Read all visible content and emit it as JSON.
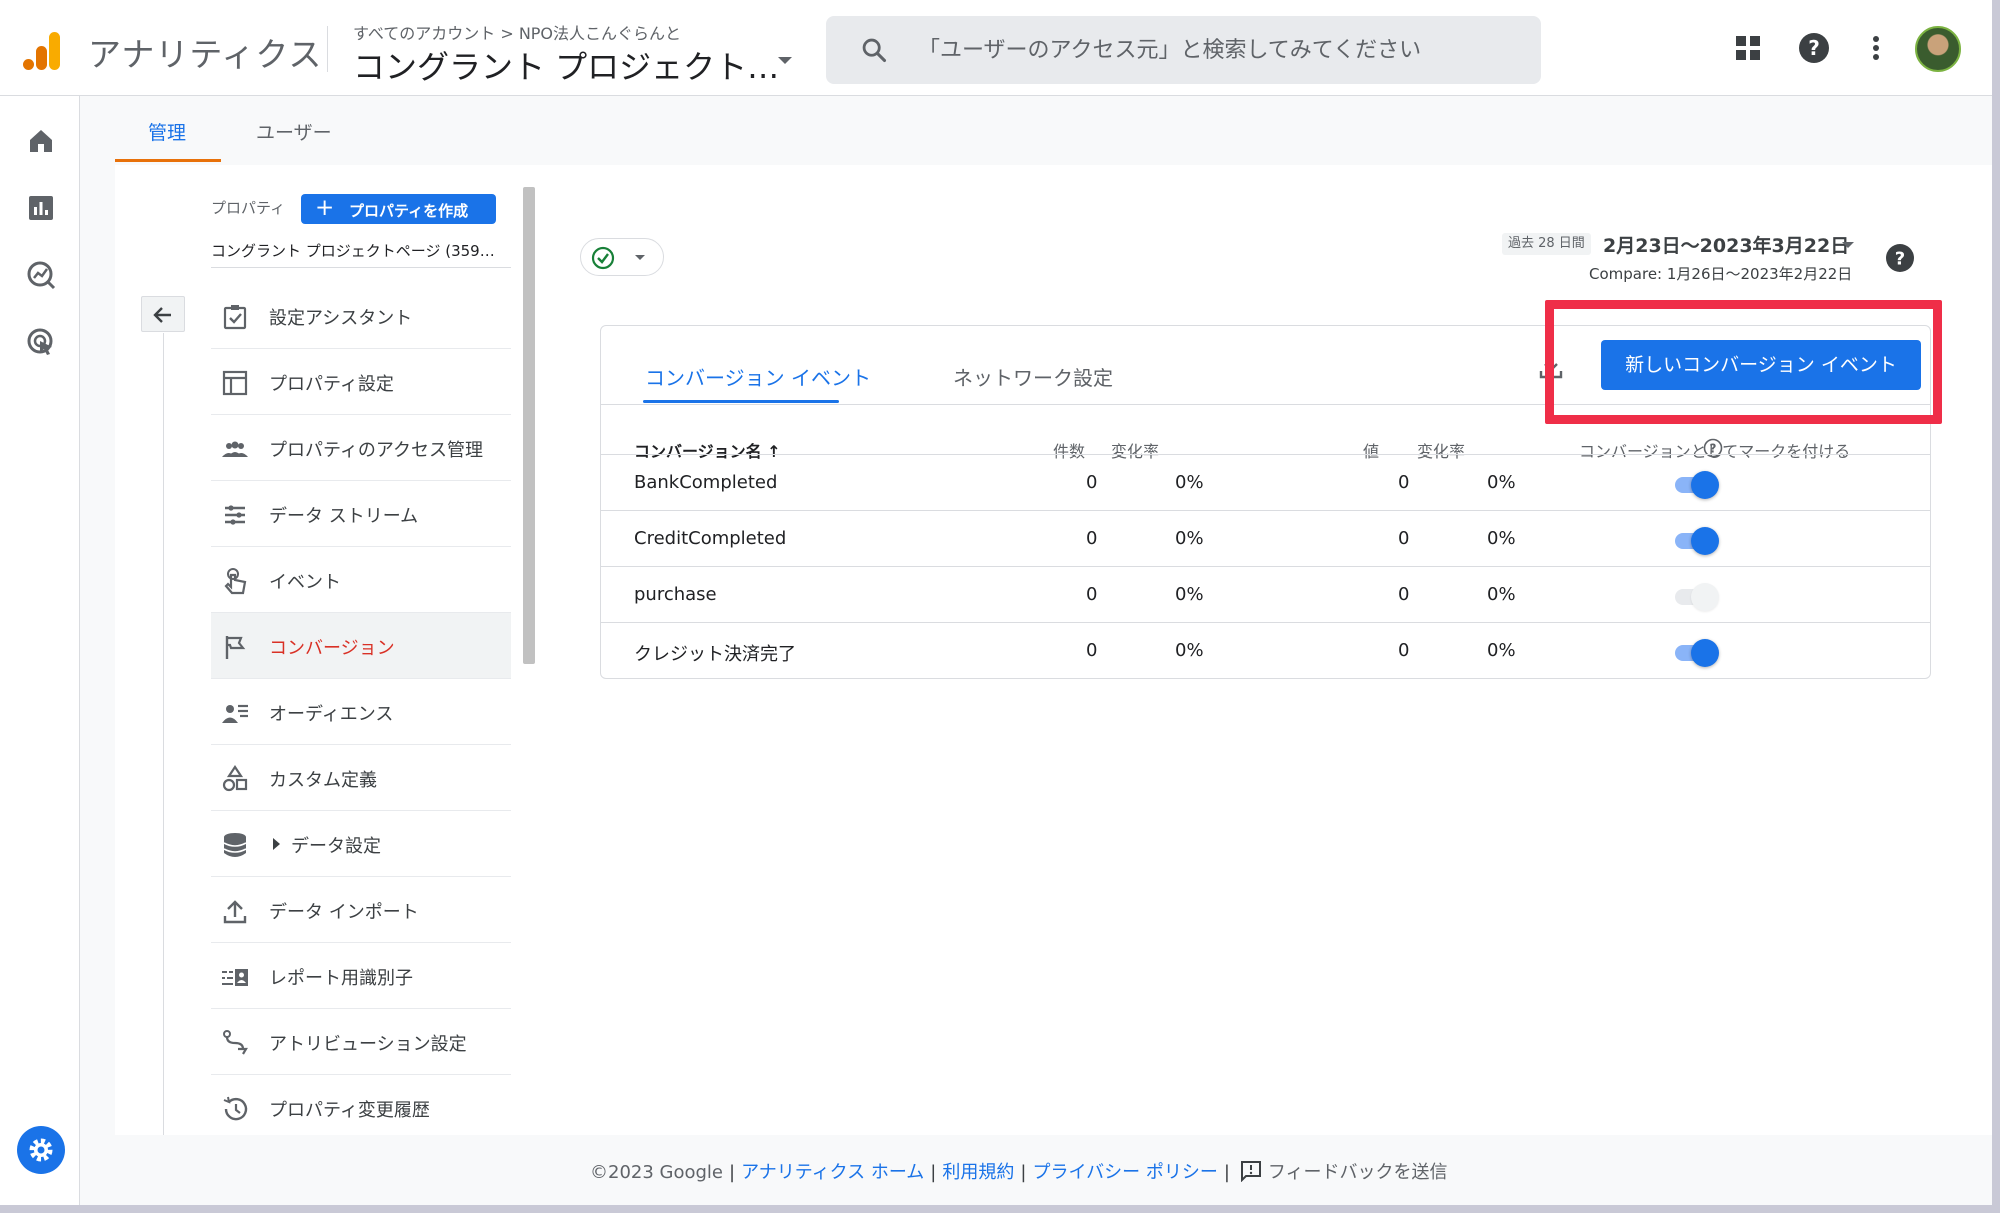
{
  "header": {
    "app_name": "アナリティクス",
    "breadcrumb": "すべてのアカウント > NPO法人こんぐらんと",
    "property_title": "コングラント プロジェクト…",
    "search_placeholder": "「ユーザーのアクセス元」と検索してみてください"
  },
  "admin_tabs": [
    {
      "label": "管理",
      "active": true
    },
    {
      "label": "ユーザー",
      "active": false
    }
  ],
  "property_column": {
    "label": "プロパティ",
    "create_button": "プロパティを作成",
    "property_name": "コングラント プロジェクトページ (359…",
    "menu": [
      {
        "label": "設定アシスタント",
        "icon": "checklist-icon",
        "active": false
      },
      {
        "label": "プロパティ設定",
        "icon": "layout-icon",
        "active": false
      },
      {
        "label": "プロパティのアクセス管理",
        "icon": "people-icon",
        "active": false
      },
      {
        "label": "データ ストリーム",
        "icon": "streams-icon",
        "active": false
      },
      {
        "label": "イベント",
        "icon": "touch-icon",
        "active": false
      },
      {
        "label": "コンバージョン",
        "icon": "flag-icon",
        "active": true
      },
      {
        "label": "オーディエンス",
        "icon": "audience-icon",
        "active": false
      },
      {
        "label": "カスタム定義",
        "icon": "shapes-icon",
        "active": false
      },
      {
        "label": "データ設定",
        "icon": "database-icon",
        "active": false,
        "expandable": true
      },
      {
        "label": "データ インポート",
        "icon": "upload-icon",
        "active": false
      },
      {
        "label": "レポート用識別子",
        "icon": "identity-icon",
        "active": false
      },
      {
        "label": "アトリビューション設定",
        "icon": "attribution-icon",
        "active": false
      },
      {
        "label": "プロパティ変更履歴",
        "icon": "history-icon",
        "active": false
      }
    ]
  },
  "date": {
    "badge": "過去 28 日間",
    "range": "2月23日〜2023年3月22日",
    "compare": "Compare: 1月26日〜2023年2月22日"
  },
  "card": {
    "tabs": [
      {
        "label": "コンバージョン イベント",
        "active": true
      },
      {
        "label": "ネットワーク設定",
        "active": false
      }
    ],
    "new_button": "新しいコンバージョン イベント",
    "headers": {
      "name": "コンバージョン名 ↑",
      "count": "件数",
      "count_change": "変化率",
      "value": "値",
      "value_change": "変化率",
      "mark": "コンバージョンとしてマークを付ける"
    },
    "rows": [
      {
        "name": "BankCompleted",
        "count": "0",
        "count_change": "0%",
        "value": "0",
        "value_change": "0%",
        "marked": true
      },
      {
        "name": "CreditCompleted",
        "count": "0",
        "count_change": "0%",
        "value": "0",
        "value_change": "0%",
        "marked": true
      },
      {
        "name": "purchase",
        "count": "0",
        "count_change": "0%",
        "value": "0",
        "value_change": "0%",
        "marked": false
      },
      {
        "name": "クレジット決済完了",
        "count": "0",
        "count_change": "0%",
        "value": "0",
        "value_change": "0%",
        "marked": true
      }
    ]
  },
  "footer": {
    "copyright": "©2023 Google",
    "links": [
      "アナリティクス ホーム",
      "利用規約",
      "プライバシー ポリシー"
    ],
    "feedback": "フィードバックを送信"
  },
  "colors": {
    "accent": "#1a73e8",
    "active_nav": "#d93025",
    "tab_indicator": "#e8710a",
    "highlight": "#ef2e48"
  }
}
